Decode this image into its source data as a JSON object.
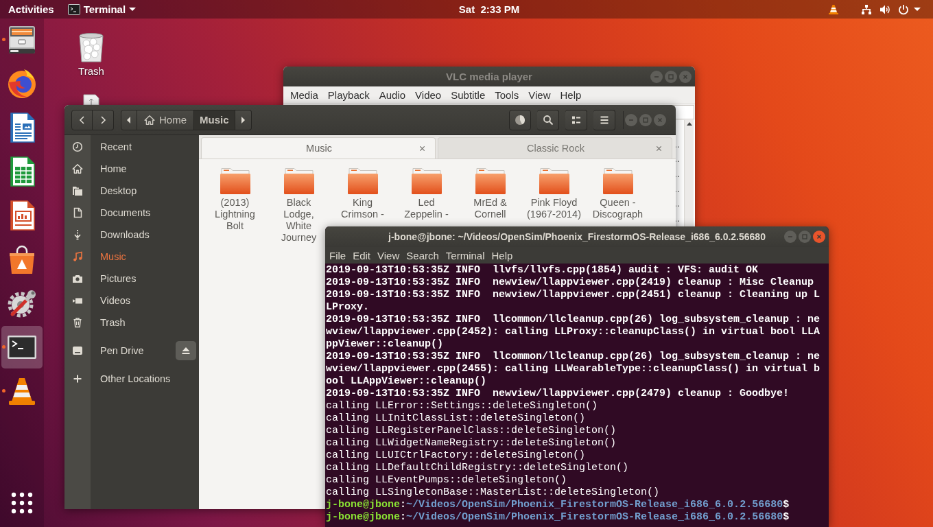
{
  "top_bar": {
    "activities": "Activities",
    "app_menu": "Terminal",
    "clock": "Sat  2:33 PM",
    "tray": [
      {
        "kind": "cone"
      },
      {
        "kind": "network"
      },
      {
        "kind": "volume"
      },
      {
        "kind": "power"
      }
    ]
  },
  "dock": {
    "items": [
      {
        "kind": "files",
        "running": true,
        "selected": false
      },
      {
        "kind": "browser",
        "running": false,
        "selected": false
      },
      {
        "kind": "writer",
        "running": false,
        "selected": false
      },
      {
        "kind": "calc",
        "running": false,
        "selected": false
      },
      {
        "kind": "impress",
        "running": false,
        "selected": false
      },
      {
        "kind": "software",
        "running": false,
        "selected": false
      },
      {
        "kind": "tools",
        "running": false,
        "selected": false
      },
      {
        "kind": "terminal",
        "running": true,
        "selected": true
      },
      {
        "kind": "vlc",
        "running": true,
        "selected": false
      }
    ]
  },
  "desktop": {
    "icons": [
      {
        "kind": "trash",
        "label": "Trash"
      },
      {
        "kind": "file"
      }
    ]
  },
  "vlc_window": {
    "title": "VLC media player",
    "active": false,
    "menu": [
      "Media",
      "Playback",
      "Audio",
      "Video",
      "Subtitle",
      "Tools",
      "View",
      "Help"
    ],
    "playlist_rows": [
      "…",
      "…",
      "…",
      "…",
      "…",
      "…"
    ]
  },
  "files_window": {
    "active": false,
    "breadcrumb": [
      {
        "kind": "home",
        "label": "Home",
        "selected": false
      },
      {
        "kind": "folder",
        "label": "Music",
        "selected": true
      }
    ],
    "sidebar": {
      "items": [
        {
          "kind": "recent",
          "label": "Recent",
          "selected": false
        },
        {
          "kind": "home",
          "label": "Home",
          "selected": false
        },
        {
          "kind": "desktop",
          "label": "Desktop",
          "selected": false
        },
        {
          "kind": "documents",
          "label": "Documents",
          "selected": false
        },
        {
          "kind": "downloads",
          "label": "Downloads",
          "selected": false
        },
        {
          "kind": "music",
          "label": "Music",
          "selected": true
        },
        {
          "kind": "pictures",
          "label": "Pictures",
          "selected": false
        },
        {
          "kind": "videos",
          "label": "Videos",
          "selected": false
        },
        {
          "kind": "trash",
          "label": "Trash",
          "selected": false
        },
        {
          "kind": "drive",
          "label": "Pen Drive",
          "selected": false
        },
        {
          "kind": "other",
          "label": "Other Locations",
          "selected": false
        }
      ]
    },
    "tabs": [
      {
        "label": "Music",
        "selected": true
      },
      {
        "label": "Classic Rock",
        "selected": false
      }
    ],
    "folders": [
      "(2013) Lightning Bolt",
      "Black Lodge, White Journey",
      "King Crimson -",
      "Led Zeppelin -",
      "MrEd & Cornell",
      "Pink Floyd (1967-2014)",
      "Queen - Discograph"
    ]
  },
  "terminal_window": {
    "title": "j-bone@jbone: ~/Videos/OpenSim/Phoenix_FirestormOS-Release_i686_6.0.2.56680",
    "active": true,
    "menu": [
      "File",
      "Edit",
      "View",
      "Search",
      "Terminal",
      "Help"
    ],
    "lines": [
      {
        "kind": "info",
        "text": "2019-09-13T10:53:35Z INFO  llvfs/llvfs.cpp(1854) audit : VFS: audit OK"
      },
      {
        "kind": "info",
        "text": "2019-09-13T10:53:35Z INFO  newview/llappviewer.cpp(2419) cleanup : Misc Cleanup"
      },
      {
        "kind": "info",
        "text": "2019-09-13T10:53:35Z INFO  newview/llappviewer.cpp(2451) cleanup : Cleaning up LLProxy."
      },
      {
        "kind": "info",
        "text": "2019-09-13T10:53:35Z INFO  llcommon/llcleanup.cpp(26) log_subsystem_cleanup : newview/llappviewer.cpp(2452): calling LLProxy::cleanupClass() in virtual bool LLAppViewer::cleanup()"
      },
      {
        "kind": "info",
        "text": "2019-09-13T10:53:35Z INFO  llcommon/llcleanup.cpp(26) log_subsystem_cleanup : newview/llappviewer.cpp(2455): calling LLWearableType::cleanupClass() in virtual bool LLAppViewer::cleanup()"
      },
      {
        "kind": "info",
        "text": "2019-09-13T10:53:35Z INFO  newview/llappviewer.cpp(2479) cleanup : Goodbye!"
      },
      {
        "kind": "output",
        "text": "calling LLError::Settings::deleteSingleton()"
      },
      {
        "kind": "output",
        "text": "calling LLInitClassList::deleteSingleton()"
      },
      {
        "kind": "output",
        "text": "calling LLRegisterPanelClass::deleteSingleton()"
      },
      {
        "kind": "output",
        "text": "calling LLWidgetNameRegistry::deleteSingleton()"
      },
      {
        "kind": "output",
        "text": "calling LLUICtrlFactory::deleteSingleton()"
      },
      {
        "kind": "output",
        "text": "calling LLDefaultChildRegistry::deleteSingleton()"
      },
      {
        "kind": "output",
        "text": "calling LLEventPumps::deleteSingleton()"
      },
      {
        "kind": "output",
        "text": "calling LLSingletonBase::MasterList::deleteSingleton()"
      },
      {
        "kind": "prompt",
        "user": "j-bone@jbone",
        "separator": ":",
        "path": "~/Videos/OpenSim/Phoenix_FirestormOS-Release_i686_6.0.2.56680",
        "symbol": "$"
      },
      {
        "kind": "prompt",
        "user": "j-bone@jbone",
        "separator": ":",
        "path": "~/Videos/OpenSim/Phoenix_FirestormOS-Release_i686_6.0.2.56680",
        "symbol": "$"
      }
    ]
  }
}
